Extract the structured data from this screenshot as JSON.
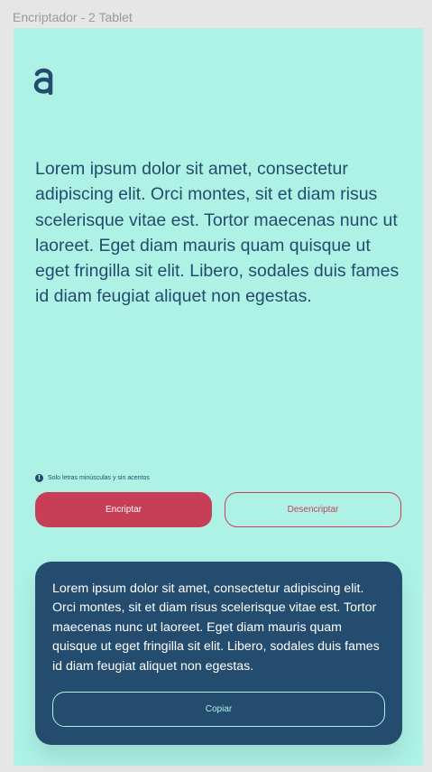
{
  "frame": {
    "label": "Encriptador - 2 Tablet"
  },
  "logo": {
    "icon": "alura-logo-icon",
    "color": "#234c6e"
  },
  "input": {
    "text": "Lorem ipsum dolor sit amet, consectetur adipiscing elit. Orci montes, sit et diam risus scelerisque vitae est. Tortor maecenas nunc ut laoreet. Eget diam mauris quam quisque ut eget fringilla sit elit. Libero, sodales duis fames id diam feugiat aliquet non egestas."
  },
  "hint": {
    "icon": "info-icon",
    "text": "Solo letras minúsculas y sin acentos"
  },
  "buttons": {
    "encrypt_label": "Encriptar",
    "decrypt_label": "Desencriptar"
  },
  "output": {
    "text": "Lorem ipsum dolor sit amet, consectetur adipiscing elit. Orci montes, sit et diam risus scelerisque vitae est. Tortor maecenas nunc ut laoreet. Eget diam mauris quam quisque ut eget fringilla sit elit. Libero, sodales duis fames id diam feugiat aliquet non egestas.",
    "copy_label": "Copiar"
  },
  "colors": {
    "background": "#aef2e6",
    "primary": "#234c6e",
    "accent": "#c63f57",
    "canvas": "#e6e6e6"
  }
}
